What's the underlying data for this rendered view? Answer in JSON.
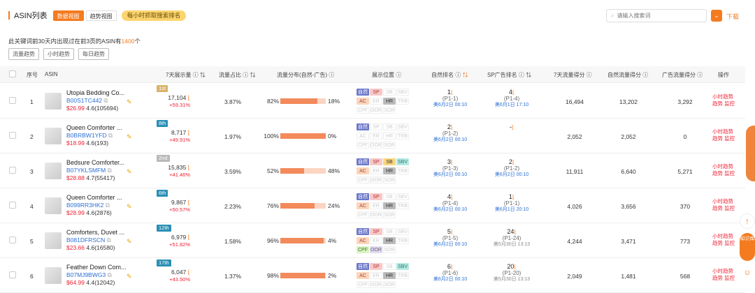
{
  "header": {
    "title": "ASIN列表",
    "tabs": [
      "数据视图",
      "趋势视图"
    ],
    "pill": "每小时抓取搜索排名",
    "search_placeholder": "请输入搜索词",
    "download": "下载"
  },
  "summary": {
    "prefix": "此关键词前30天内出现过在前3页的ASIN有",
    "count": "1400",
    "suffix": "个"
  },
  "trend_buttons": [
    "流量趋势",
    "小时趋势",
    "每日趋势"
  ],
  "columns": [
    "序号",
    "ASIN",
    "7天展示量",
    "流量占比",
    "流量分布(自然-广告)",
    "展示位置",
    "自然排名",
    "SP广告排名",
    "7天流量得分",
    "自然流量得分",
    "广告流量得分",
    "操作"
  ],
  "ops": [
    "小时趋势",
    "趋势",
    "监控"
  ],
  "rows": [
    {
      "idx": "1",
      "name": "Utopia Bedding Co...",
      "asin": "B00S1TC442",
      "price": "$26.99",
      "rating": "4.6(105694)",
      "badge": "1st",
      "badge_color": "#d9b36a",
      "disp": "17,104",
      "chg": "+59.31%",
      "share": "3.87%",
      "l": "82%",
      "r": "18%",
      "lp": 82,
      "nat": "1",
      "nat_sub": "(P1-1)",
      "nat_date": "美6月2日 00:10",
      "sp": "4",
      "sp_sub": "(P1-4)",
      "sp_date": "美6月1日 17:10",
      "s7": "16,494",
      "snat": "13,202",
      "sad": "3,292",
      "pos": [
        "on-blue",
        "on-pink",
        "",
        "",
        "on-orange",
        "",
        "on-gray",
        "",
        "",
        "",
        ""
      ]
    },
    {
      "idx": "2",
      "name": "Queen Comforter ...",
      "asin": "B0BRBW1YFD",
      "price": "$18.99",
      "rating": "4.6(193)",
      "badge": "8th",
      "badge_color": "#2a8fb5",
      "disp": "8,717",
      "chg": "+49.91%",
      "share": "1.97%",
      "l": "100%",
      "r": "0%",
      "lp": 100,
      "nat": "2",
      "nat_sub": "(P1-2)",
      "nat_date": "美6月2日 00:10",
      "sp": "-",
      "sp_sub": "",
      "sp_date": "",
      "s7": "2,052",
      "snat": "2,052",
      "sad": "0",
      "pos": [
        "on-blue",
        "",
        "",
        "",
        "",
        "",
        "",
        "",
        "",
        "",
        ""
      ]
    },
    {
      "idx": "3",
      "name": "Bedsure Comforter...",
      "asin": "B07YKLSMFM",
      "price": "$28.88",
      "rating": "4.7(55417)",
      "badge": "2nd",
      "badge_color": "#b9b9b9",
      "disp": "15,835",
      "chg": "+41.46%",
      "share": "3.59%",
      "l": "52%",
      "r": "48%",
      "lp": 52,
      "nat": "3",
      "nat_sub": "(P1-3)",
      "nat_date": "美6月2日 00:10",
      "sp": "2",
      "sp_sub": "(P1-2)",
      "sp_date": "美6月2日 00:10",
      "s7": "11,911",
      "snat": "6,640",
      "sad": "5,271",
      "pos": [
        "on-blue",
        "on-pink",
        "on-yellow",
        "on-teal",
        "on-orange",
        "",
        "on-gray",
        "",
        "",
        "",
        ""
      ]
    },
    {
      "idx": "4",
      "name": "Queen Comforter ...",
      "asin": "B099RR3HK2",
      "price": "$28.99",
      "rating": "4.6(2876)",
      "badge": "6th",
      "badge_color": "#2a8fb5",
      "disp": "9,867",
      "chg": "+50.57%",
      "share": "2.23%",
      "l": "76%",
      "r": "24%",
      "lp": 76,
      "nat": "4",
      "nat_sub": "(P1-4)",
      "nat_date": "美6月2日 00:10",
      "sp": "1",
      "sp_sub": "(P1-1)",
      "sp_date": "美6月1日 20:10",
      "s7": "4,026",
      "snat": "3,656",
      "sad": "370",
      "pos": [
        "on-blue",
        "on-pink",
        "",
        "",
        "on-orange",
        "",
        "on-gray",
        "",
        "",
        "",
        ""
      ]
    },
    {
      "idx": "5",
      "name": "Comforters, Duvet ...",
      "asin": "B081DFRSCN",
      "price": "$23.66",
      "rating": "4.6(16580)",
      "badge": "12th",
      "badge_color": "#2a8fb5",
      "disp": "6,979",
      "chg": "+51.82%",
      "share": "1.58%",
      "l": "96%",
      "r": "4%",
      "lp": 96,
      "nat": "5",
      "nat_sub": "(P1-5)",
      "nat_date": "美6月2日 00:10",
      "sp": "24",
      "sp_sub": "(P1-24)",
      "sp_date": "美5月30日 13:13",
      "s7": "4,244",
      "snat": "3,471",
      "sad": "773",
      "pos": [
        "on-blue",
        "on-pink",
        "",
        "",
        "on-orange",
        "",
        "on-gray",
        "",
        "on-green",
        "on-lav",
        ""
      ]
    },
    {
      "idx": "6",
      "name": "Feather Down Com...",
      "asin": "B07MJ9BWG3",
      "price": "$64.99",
      "rating": "4.4(12042)",
      "badge": "17th",
      "badge_color": "#2a8fb5",
      "disp": "6,047",
      "chg": "+43.50%",
      "share": "1.37%",
      "l": "98%",
      "r": "2%",
      "lp": 98,
      "nat": "6",
      "nat_sub": "(P1-6)",
      "nat_date": "美6月2日 00:10",
      "sp": "20",
      "sp_sub": "(P1-20)",
      "sp_date": "美5月30日 13:13",
      "s7": "2,049",
      "snat": "1,481",
      "sad": "568",
      "pos": [
        "on-blue",
        "on-pink",
        "",
        "on-teal",
        "on-orange",
        "",
        "on-gray",
        "",
        "",
        "",
        ""
      ]
    }
  ],
  "pos_labels": [
    "自然",
    "SP",
    "SB",
    "SBV",
    "AC",
    "ER",
    "HR",
    "TRB",
    "CPF",
    "OOR",
    "SOR"
  ],
  "side": {
    "knowledge": "知识库"
  }
}
